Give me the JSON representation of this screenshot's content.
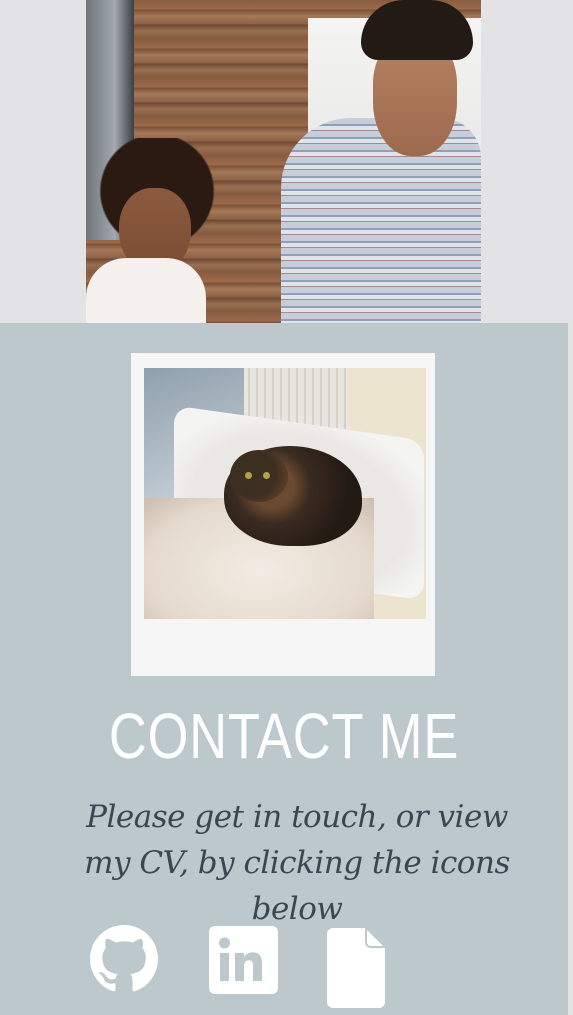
{
  "hero": {
    "image": "two-people-working-photo"
  },
  "contact": {
    "polaroid_image": "cat-on-radiator-bed-photo",
    "title": "CONTACT ME",
    "text": "Please get in touch, or view my CV, by clicking the icons below",
    "icons": [
      {
        "name": "github-icon",
        "color": "#ffffff"
      },
      {
        "name": "linkedin-icon",
        "color": "#ffffff"
      },
      {
        "name": "file-icon",
        "color": "#ffffff"
      }
    ],
    "colors": {
      "section_background": "#bdc8cc",
      "title": "#ffffff",
      "text": "#3a4750"
    }
  }
}
